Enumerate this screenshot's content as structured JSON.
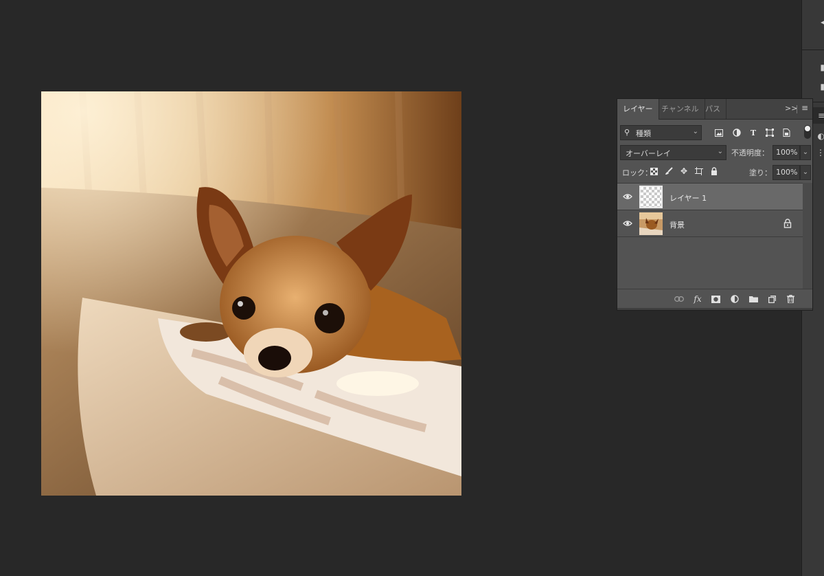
{
  "canvas": {
    "image": "chihuahua-on-cushion-photo"
  },
  "layers_panel": {
    "tabs": [
      {
        "label": "レイヤー",
        "active": true
      },
      {
        "label": "チャンネル",
        "active": false
      },
      {
        "label": "パス",
        "active": false
      }
    ],
    "filter": {
      "kind_label": "種類",
      "icons": [
        "image-filter-icon",
        "adjustment-filter-icon",
        "type-filter-icon",
        "shape-filter-icon",
        "smart-object-filter-icon"
      ]
    },
    "blend_mode": "オーバーレイ",
    "opacity_label": "不透明度：",
    "opacity_value": "100%",
    "lock_label": "ロック：",
    "lock_icons": [
      "lock-transparent-icon",
      "lock-image-icon",
      "lock-position-icon",
      "lock-artboard-icon",
      "lock-all-icon"
    ],
    "fill_label": "塗り：",
    "fill_value": "100%",
    "layers": [
      {
        "name": "レイヤー 1",
        "visible": true,
        "selected": true,
        "locked": false
      },
      {
        "name": "背景",
        "visible": true,
        "selected": false,
        "locked": true
      }
    ],
    "footer_icons": [
      "link-layers-icon",
      "fx-icon",
      "layer-mask-icon",
      "adjustment-layer-icon",
      "group-folder-icon",
      "new-layer-icon",
      "delete-layer-icon"
    ],
    "fx_label": "fx"
  },
  "colors": {
    "app_background": "#282828",
    "panel_background": "#535353",
    "selected_layer": "#696969"
  }
}
